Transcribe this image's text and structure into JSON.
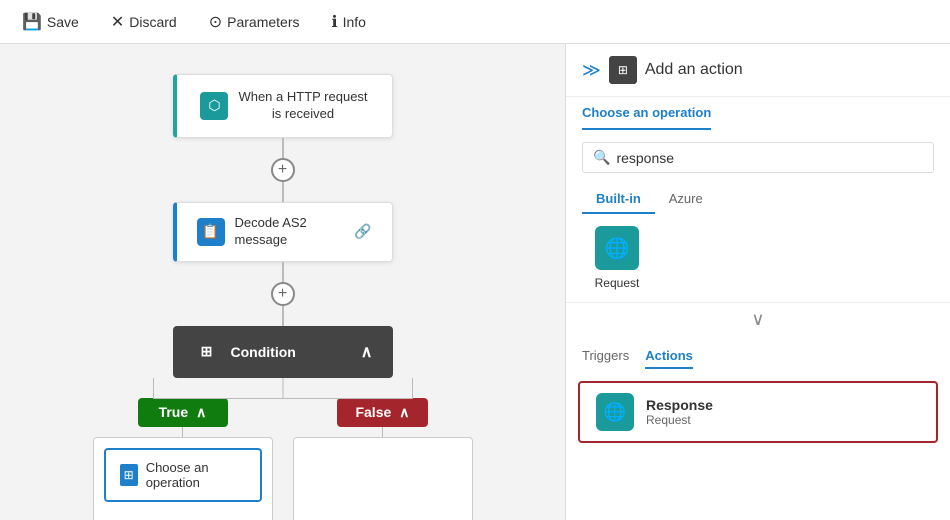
{
  "toolbar": {
    "save_label": "Save",
    "discard_label": "Discard",
    "parameters_label": "Parameters",
    "info_label": "Info"
  },
  "canvas": {
    "node_http": {
      "title_line1": "When a HTTP request",
      "title_line2": "is received"
    },
    "node_decode": {
      "title": "Decode AS2 message"
    },
    "node_condition": {
      "title": "Condition"
    },
    "branch_true": "True",
    "branch_false": "False",
    "choose_operation": "Choose an operation"
  },
  "right_panel": {
    "header": {
      "title": "Add an action",
      "tab": "Choose an operation"
    },
    "search": {
      "placeholder": "response",
      "value": "response"
    },
    "filter_tabs": [
      {
        "label": "Built-in",
        "active": true
      },
      {
        "label": "Azure",
        "active": false
      }
    ],
    "operations": [
      {
        "label": "Request",
        "icon": "🌐"
      }
    ],
    "actions_tabs": [
      {
        "label": "Triggers",
        "active": false
      },
      {
        "label": "Actions",
        "active": true
      }
    ],
    "action_items": [
      {
        "name": "Response",
        "sub": "Request",
        "icon": "🌐",
        "selected": true
      }
    ]
  }
}
